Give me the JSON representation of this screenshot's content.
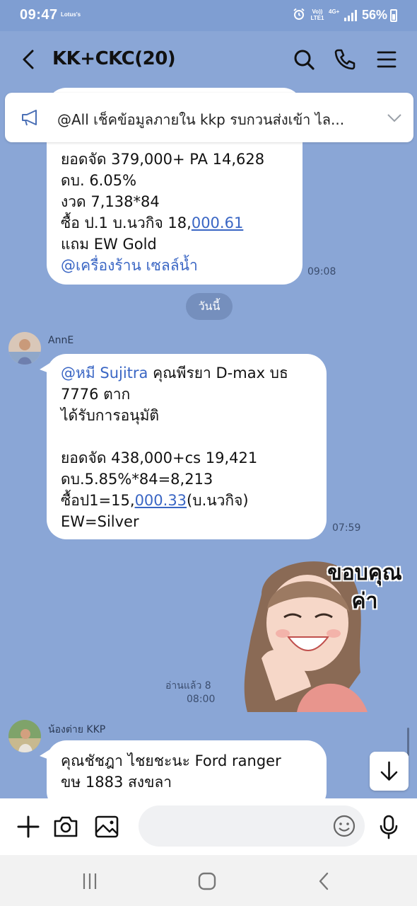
{
  "status_bar": {
    "time": "09:47",
    "carrier_badge": "Lotus's",
    "volte_label": "Vo)) LTE1",
    "network": "4G+",
    "battery": "56%"
  },
  "header": {
    "title": "KK+CKC(20)",
    "icons": [
      "back-icon",
      "search-icon",
      "phone-icon",
      "menu-icon"
    ]
  },
  "announcement": {
    "text": "@All  เช็คข้อมูลภายใน kkp รบกวนส่งเข้า ไล..."
  },
  "messages": [
    {
      "id": "msg-1",
      "lines": [
        "ยอดจัด 379,000+ PA 14,628",
        "ดบ. 6.05%",
        "งวด 7,138*84"
      ],
      "buy_line_prefix": "ซื้อ ป.1 บ.นวกิจ 18,",
      "buy_line_link": "000.61",
      "extra_line": "แถม EW Gold",
      "mention": "@เครื่องร้าน เซลล์น้ำ",
      "time": "09:08"
    },
    {
      "id": "msg-2",
      "sender": "AnnE",
      "mention": "@หมี Sujitra",
      "line1_rest": " คุณพีรยา D-max บธ",
      "line2": "7776 ตาก",
      "line3": "ได้รับการอนุมัติ",
      "line4": "ยอดจัด 438,000+cs 19,421",
      "line5": "ดบ.5.85%*84=8,213",
      "buy_prefix": "ซื้อป1=15,",
      "buy_link": "000.33",
      "buy_suffix": "(บ.นวกิจ)",
      "line7": "EW=Silver",
      "time": "07:59"
    },
    {
      "id": "msg-3",
      "sticker_text": "ขอบคุณ ค่า",
      "read_label": "อ่านแล้ว 8",
      "time": "08:00"
    },
    {
      "id": "msg-4",
      "sender": "น้องต่าย KKP",
      "line1": "คุณชัชฎา ไชยชะนะ Ford ranger",
      "line2": "ขษ 1883 สงขลา"
    }
  ],
  "date_separator": "วันนี้",
  "input_bar": {
    "placeholder": "",
    "icons": [
      "plus-icon",
      "camera-icon",
      "image-icon",
      "emoji-icon",
      "mic-icon"
    ]
  },
  "colors": {
    "background": "#8aa6d6",
    "mention": "#3a66c4",
    "bubble": "#ffffff"
  }
}
